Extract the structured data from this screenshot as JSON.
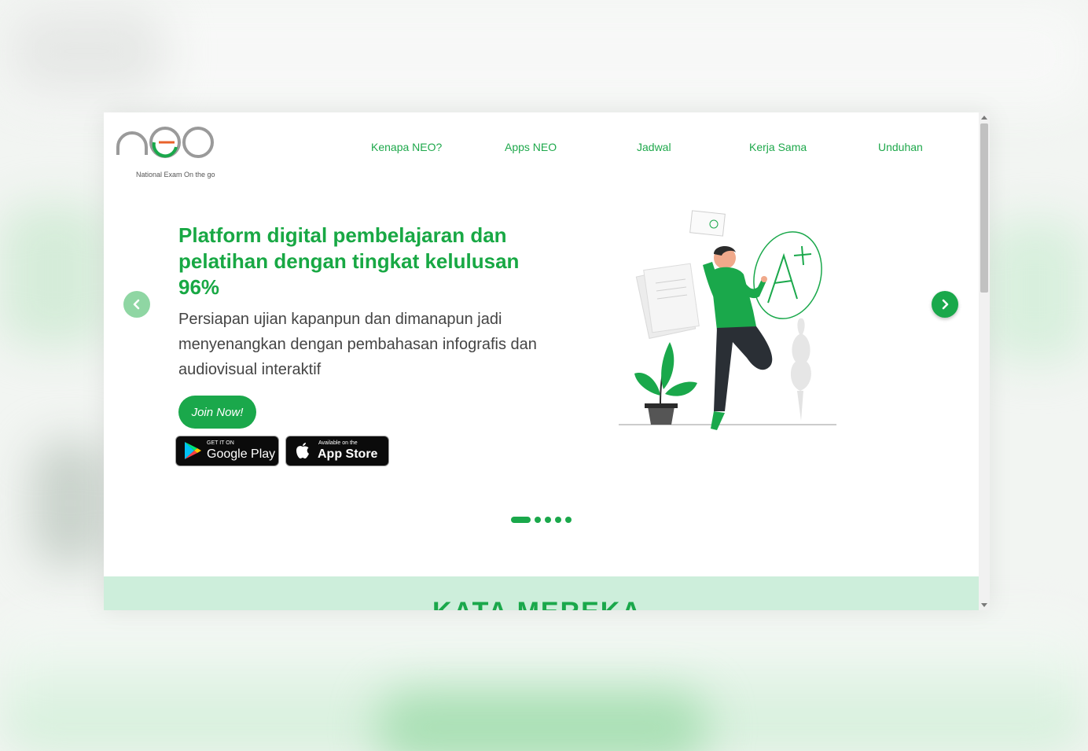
{
  "header": {
    "logo_text": "neo",
    "logo_tagline": "National Exam On the go",
    "nav": [
      "Kenapa NEO?",
      "Apps NEO",
      "Jadwal",
      "Kerja Sama",
      "Unduhan"
    ]
  },
  "hero": {
    "title": "Platform digital pembelajaran dan pelatihan dengan tingkat kelulusan 96%",
    "subtitle": "Persiapan ujian kapanpun dan dimanapun jadi menyenangkan dengan pembahasan infografis dan audiovisual interaktif",
    "cta_label": "Join Now!",
    "google_play": {
      "small": "GET IT ON",
      "big": "Google Play"
    },
    "app_store": {
      "small": "Available on the",
      "big": "App Store"
    }
  },
  "carousel": {
    "slide_count": 5,
    "active_index": 0,
    "prev_icon": "chevron-left-icon",
    "next_icon": "chevron-right-icon"
  },
  "section": {
    "title": "KATA MEREKA"
  },
  "colors": {
    "brand_green": "#1aa84b",
    "light_green": "#cdeedb",
    "arrow_inactive": "#8fd6a3",
    "logo_orange": "#e8622b"
  }
}
